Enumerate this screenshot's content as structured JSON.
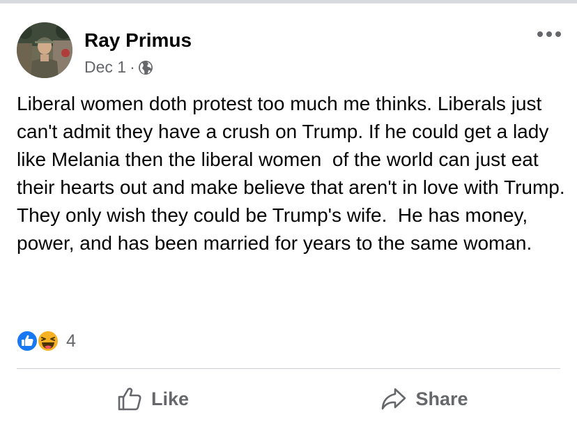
{
  "post": {
    "author": "Ray Primus",
    "date": "Dec 1",
    "separator": "·",
    "privacy_icon": "globe-icon",
    "more_icon": "more-options-icon",
    "text": "Liberal women doth protest too much me thinks. Liberals just can't admit they have a crush on Trump. If he could get a lady like Melania then the liberal women  of the world can just eat their hearts out and make believe that aren't in love with Trump.\nThey only wish they could be Trump's wife.  He has money, power, and has been married for years to the same woman.",
    "reactions": {
      "types": [
        "like-reaction-icon",
        "haha-reaction-icon"
      ],
      "count": "4"
    }
  },
  "actions": {
    "like_label": "Like",
    "share_label": "Share"
  },
  "colors": {
    "primary_text": "#050505",
    "secondary_text": "#65676b",
    "like_blue": "#1877f2",
    "haha_yellow": "#f7b125",
    "divider": "#ced0d4",
    "top_border": "#d8dadf"
  }
}
